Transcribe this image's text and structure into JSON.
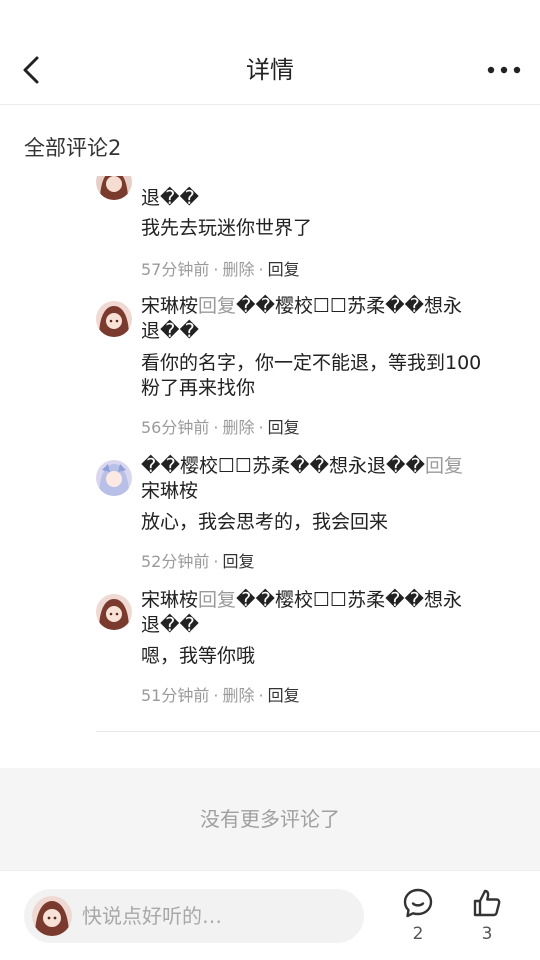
{
  "header": {
    "title": "详情"
  },
  "section": {
    "title": "全部评论2"
  },
  "comments": [
    {
      "partial_text": "退��",
      "body": "我先去玩迷你世界了",
      "time": "57分钟前",
      "delete": "删除",
      "reply": "回复"
    },
    {
      "author": "宋琳桉",
      "reply_word": "回复",
      "target_line1": "��樱校☐☐苏柔��想永",
      "target_line2": "退��",
      "body_line1": "看你的名字，你一定不能退，等我到100",
      "body_line2": "粉了再来找你",
      "time": "56分钟前",
      "delete": "删除",
      "reply": "回复"
    },
    {
      "author": "��樱校☐☐苏柔��想永退��",
      "reply_word": "回复",
      "target": "宋琳桉",
      "body": "放心，我会思考的，我会回来",
      "time": "52分钟前",
      "reply": "回复"
    },
    {
      "author": "宋琳桉",
      "reply_word": "回复",
      "target_line1": "��樱校☐☐苏柔��想永",
      "target_line2": "退��",
      "body": "嗯，我等你哦",
      "time": "51分钟前",
      "delete": "删除",
      "reply": "回复"
    }
  ],
  "no_more_text": "没有更多评论了",
  "footer": {
    "input_placeholder": "快说点好听的…",
    "comment_count": "2",
    "like_count": "3"
  },
  "colors": {
    "secondary_text": "#9a9a9a",
    "primary_text": "#222222",
    "empty_bg": "#f5f5f5"
  }
}
